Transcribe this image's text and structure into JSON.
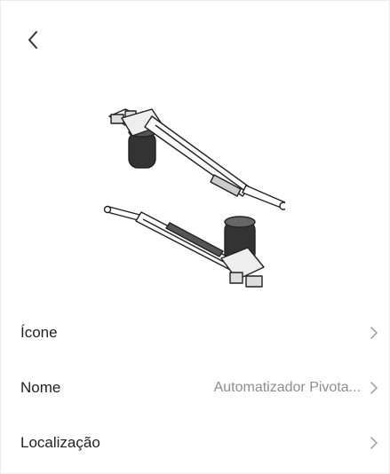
{
  "header": {
    "back_icon": "chevron-left-icon"
  },
  "device_image": {
    "description_icon": "linear-actuator-illustration"
  },
  "settings": {
    "rows": [
      {
        "label": "Ícone",
        "value": ""
      },
      {
        "label": "Nome",
        "value": "Automatizador Pivota..."
      },
      {
        "label": "Localização",
        "value": ""
      }
    ]
  },
  "colors": {
    "label": "#222222",
    "value": "#8e8e8e",
    "chevron": "#9a9a9a"
  }
}
